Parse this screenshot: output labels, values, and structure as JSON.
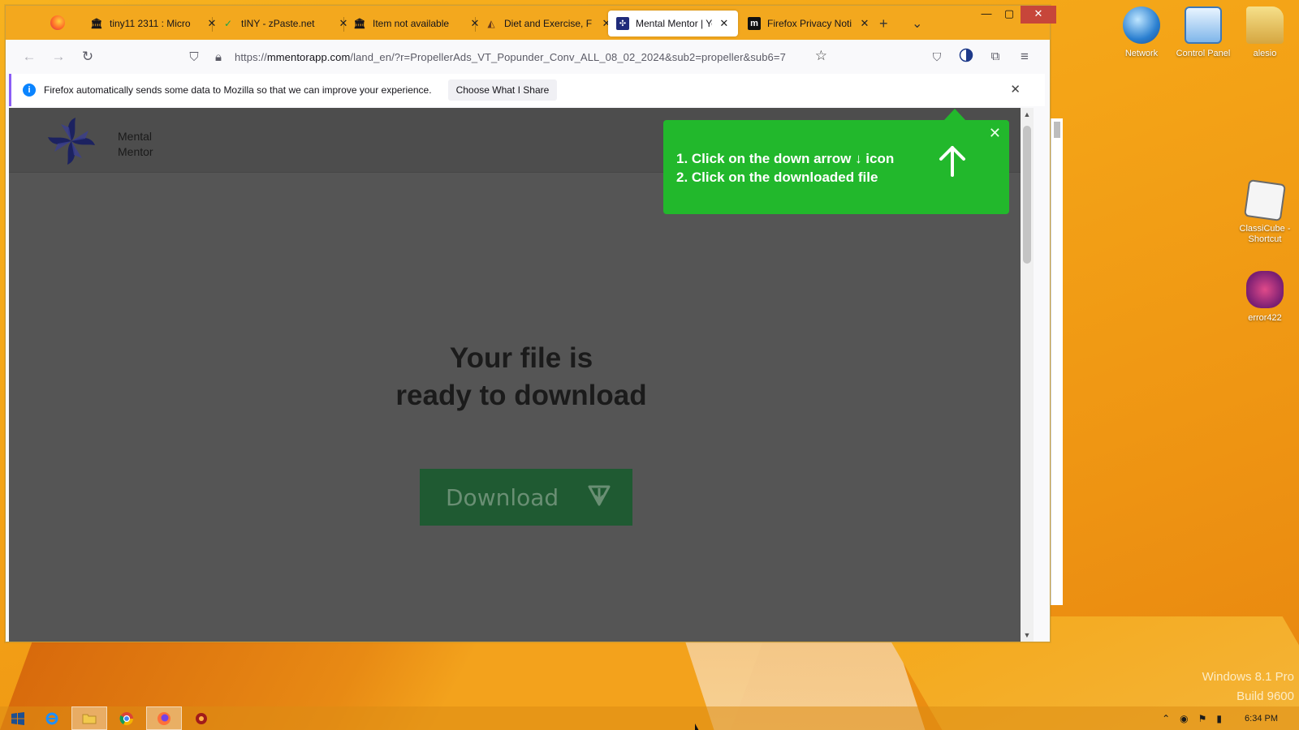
{
  "browser": {
    "tabs": [
      {
        "label": "tiny11 2311 : Micro",
        "icon": "archive-icon",
        "active": false
      },
      {
        "label": "tINY - zPaste.net",
        "icon": "zpaste-icon",
        "active": false
      },
      {
        "label": "Item not available",
        "icon": "archive-icon",
        "active": false
      },
      {
        "label": "Diet and Exercise, F",
        "icon": "site-icon",
        "active": false
      },
      {
        "label": "Mental Mentor | Yo",
        "icon": "mentalmentor-icon",
        "active": true
      },
      {
        "label": "Firefox Privacy Noti",
        "icon": "mozilla-icon",
        "active": false
      }
    ],
    "new_tab": "+",
    "list_tabs": "⌄",
    "url": {
      "prefix": "https://",
      "host": "mmentorapp.com",
      "path": "/land_en/?r=PropellerAds_VT_Popunder_Conv_ALL_08_02_2024&sub2=propeller&sub6=7"
    },
    "infobar": {
      "message": "Firefox automatically sends some data to Mozilla so that we can improve your experience.",
      "button": "Choose What I Share"
    }
  },
  "page": {
    "logo_line1": "Mental",
    "logo_line2": "Mentor",
    "headline_line1": "Your file is",
    "headline_line2": "ready to download",
    "download_label": "Download",
    "tooltip": {
      "step1": "1. Click on the down arrow ↓ icon",
      "step2": "2. Click on the downloaded file"
    }
  },
  "desktop": {
    "icons": [
      {
        "label": "Network",
        "icon": "network-icon"
      },
      {
        "label": "Control Panel",
        "icon": "control-panel-icon"
      },
      {
        "label": "alesio",
        "icon": "user-folder-icon"
      },
      {
        "label": "ClassiCube - Shortcut",
        "icon": "classicube-icon"
      },
      {
        "label": "error422",
        "icon": "error422-icon"
      }
    ],
    "watermark_line1": "Windows 8.1 Pro",
    "watermark_line2": "Build 9600"
  },
  "taskbar": {
    "clock": "6:34 PM",
    "items": [
      "start",
      "internet-explorer",
      "file-explorer",
      "chrome",
      "firefox",
      "app"
    ]
  },
  "colors": {
    "tooltip": "#22b82c",
    "download_button": "#1f5a32",
    "overlay": "#555555",
    "tabbar": "#f3a81e"
  }
}
